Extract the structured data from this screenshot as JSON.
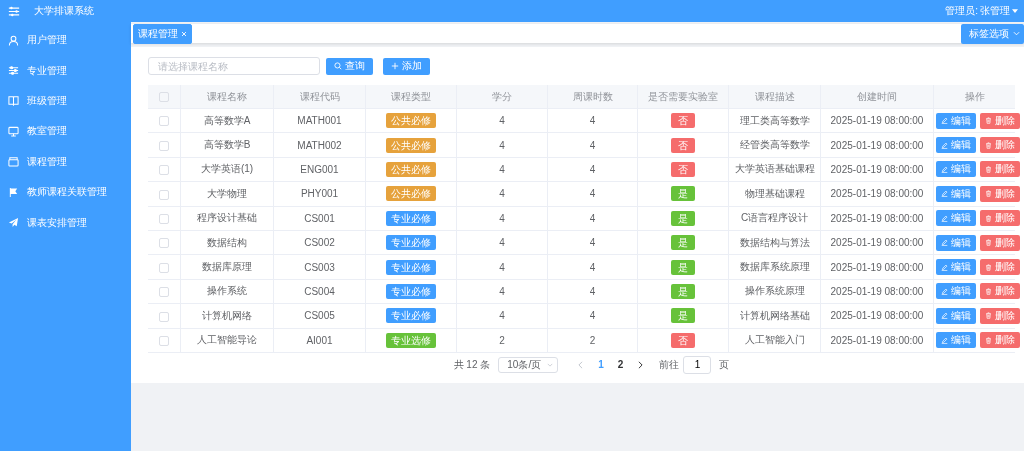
{
  "header": {
    "title": "大学排课系统",
    "user_label": "管理员:",
    "user_name": "张管理"
  },
  "sidebar": {
    "items": [
      {
        "label": "用户管理"
      },
      {
        "label": "专业管理"
      },
      {
        "label": "班级管理"
      },
      {
        "label": "教室管理"
      },
      {
        "label": "课程管理"
      },
      {
        "label": "教师课程关联管理"
      },
      {
        "label": "课表安排管理"
      }
    ]
  },
  "tabs": [
    {
      "label": "课程管理",
      "selected": true
    }
  ],
  "tab_options": "标签选项",
  "search": {
    "placeholder": "请选择课程名称",
    "query_button": "查询",
    "add_button": "添加"
  },
  "table": {
    "header_checked": false,
    "columns": [
      "课程名称",
      "课程代码",
      "课程类型",
      "学分",
      "周课时数",
      "是否需要实验室",
      "课程描述",
      "创建时间",
      "操作"
    ],
    "rows": [
      {
        "checked": false,
        "name": "高等数学A",
        "code": "MATH001",
        "type": "公共必修",
        "color": "#e6a23c",
        "credit": "4",
        "hours": "4",
        "lab": "否",
        "needs_lab": false,
        "desc": "理工类高等数学",
        "created": "2025-01-19 08:00:00",
        "edit": "编辑",
        "delete": "删除"
      },
      {
        "checked": false,
        "name": "高等数学B",
        "code": "MATH002",
        "type": "公共必修",
        "color": "#e6a23c",
        "credit": "4",
        "hours": "4",
        "lab": "否",
        "needs_lab": false,
        "desc": "经管类高等数学",
        "created": "2025-01-19 08:00:00",
        "edit": "编辑",
        "delete": "删除"
      },
      {
        "checked": false,
        "name": "大学英语(1)",
        "code": "ENG001",
        "type": "公共必修",
        "color": "#e6a23c",
        "credit": "4",
        "hours": "4",
        "lab": "否",
        "needs_lab": false,
        "desc": "大学英语基础课程",
        "created": "2025-01-19 08:00:00",
        "edit": "编辑",
        "delete": "删除"
      },
      {
        "checked": false,
        "name": "大学物理",
        "code": "PHY001",
        "type": "公共必修",
        "color": "#e6a23c",
        "credit": "4",
        "hours": "4",
        "lab": "是",
        "needs_lab": true,
        "desc": "物理基础课程",
        "created": "2025-01-19 08:00:00",
        "edit": "编辑",
        "delete": "删除"
      },
      {
        "checked": false,
        "name": "程序设计基础",
        "code": "CS001",
        "type": "专业必修",
        "color": "#409eff",
        "credit": "4",
        "hours": "4",
        "lab": "是",
        "needs_lab": true,
        "desc": "C语言程序设计",
        "created": "2025-01-19 08:00:00",
        "edit": "编辑",
        "delete": "删除"
      },
      {
        "checked": false,
        "name": "数据结构",
        "code": "CS002",
        "type": "专业必修",
        "color": "#409eff",
        "credit": "4",
        "hours": "4",
        "lab": "是",
        "needs_lab": true,
        "desc": "数据结构与算法",
        "created": "2025-01-19 08:00:00",
        "edit": "编辑",
        "delete": "删除"
      },
      {
        "checked": false,
        "name": "数据库原理",
        "code": "CS003",
        "type": "专业必修",
        "color": "#409eff",
        "credit": "4",
        "hours": "4",
        "lab": "是",
        "needs_lab": true,
        "desc": "数据库系统原理",
        "created": "2025-01-19 08:00:00",
        "edit": "编辑",
        "delete": "删除"
      },
      {
        "checked": false,
        "name": "操作系统",
        "code": "CS004",
        "type": "专业必修",
        "color": "#409eff",
        "credit": "4",
        "hours": "4",
        "lab": "是",
        "needs_lab": true,
        "desc": "操作系统原理",
        "created": "2025-01-19 08:00:00",
        "edit": "编辑",
        "delete": "删除"
      },
      {
        "checked": false,
        "name": "计算机网络",
        "code": "CS005",
        "type": "专业必修",
        "color": "#409eff",
        "credit": "4",
        "hours": "4",
        "lab": "是",
        "needs_lab": true,
        "desc": "计算机网络基础",
        "created": "2025-01-19 08:00:00",
        "edit": "编辑",
        "delete": "删除"
      },
      {
        "checked": false,
        "name": "人工智能导论",
        "code": "AI001",
        "type": "专业选修",
        "color": "#67c23a",
        "credit": "2",
        "hours": "2",
        "lab": "否",
        "needs_lab": false,
        "desc": "人工智能入门",
        "created": "2025-01-19 08:00:00",
        "edit": "编辑",
        "delete": "删除"
      }
    ]
  },
  "pagination": {
    "total": "共 12 条",
    "page_size": "10条/页",
    "pages": [
      {
        "label": "1",
        "selected": true
      },
      {
        "label": "2",
        "selected": false
      }
    ],
    "goto_label": "前往",
    "goto_value": "1",
    "goto_suffix": "页"
  }
}
